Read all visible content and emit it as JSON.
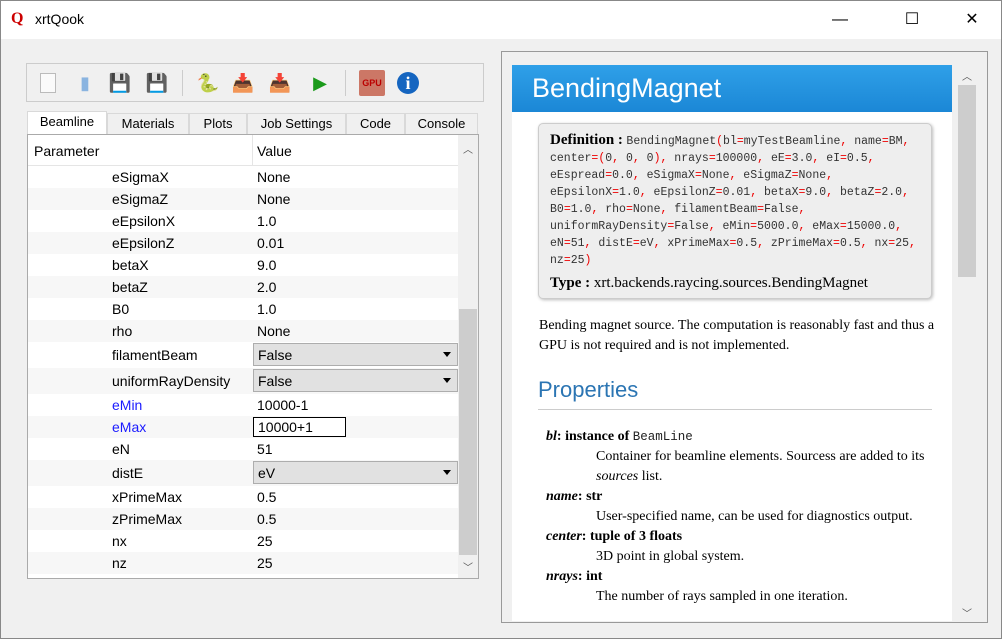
{
  "window": {
    "title": "xrtQook",
    "app_icon": "xrt",
    "minimize": "—",
    "maximize": "☐",
    "close": "✕"
  },
  "toolbar": [
    "new-icon",
    "open-icon",
    "save-icon",
    "save-as-icon",
    "python-code-icon",
    "save-python-icon",
    "save-python-as-icon",
    "run-icon",
    "gpu-icon",
    "info-icon"
  ],
  "tabs": [
    "Beamline",
    "Materials",
    "Plots",
    "Job Settings",
    "Code",
    "Console"
  ],
  "table": {
    "headers": [
      "Parameter",
      "Value"
    ],
    "rows": [
      {
        "k": "eSigmaX",
        "v": "None"
      },
      {
        "k": "eSigmaZ",
        "v": "None"
      },
      {
        "k": "eEpsilonX",
        "v": "1.0"
      },
      {
        "k": "eEpsilonZ",
        "v": "0.01"
      },
      {
        "k": "betaX",
        "v": "9.0"
      },
      {
        "k": "betaZ",
        "v": "2.0"
      },
      {
        "k": "B0",
        "v": "1.0"
      },
      {
        "k": "rho",
        "v": "None"
      },
      {
        "k": "filamentBeam",
        "v": "False",
        "combo": true
      },
      {
        "k": "uniformRayDensity",
        "v": "False",
        "combo": true
      },
      {
        "k": "eMin",
        "v": "10000-1",
        "blue": true
      },
      {
        "k": "eMax",
        "v": "10000+1",
        "blue": true,
        "edit": true
      },
      {
        "k": "eN",
        "v": "51"
      },
      {
        "k": "distE",
        "v": "eV",
        "combo": true
      },
      {
        "k": "xPrimeMax",
        "v": "0.5"
      },
      {
        "k": "zPrimeMax",
        "v": "0.5"
      },
      {
        "k": "nx",
        "v": "25"
      },
      {
        "k": "nz",
        "v": "25"
      }
    ]
  },
  "doc": {
    "title": "BendingMagnet",
    "definition_label": "Definition :",
    "definition": "BendingMagnet(bl=myTestBeamline, name=BM, center=(0, 0, 0), nrays=100000, eE=3.0, eI=0.5, eEspread=0.0, eSigmaX=None, eSigmaZ=None, eEpsilonX=1.0, eEpsilonZ=0.01, betaX=9.0, betaZ=2.0, B0=1.0, rho=None, filamentBeam=False, uniformRayDensity=False, eMin=5000.0, eMax=15000.0, eN=51, distE=eV, xPrimeMax=0.5, zPrimeMax=0.5, nx=25, nz=25)",
    "type_label": "Type :",
    "type": "xrt.backends.raycing.sources.BendingMagnet",
    "description": "Bending magnet source. The computation is reasonably fast and thus a GPU is not required and is not implemented.",
    "properties_title": "Properties",
    "properties": [
      {
        "name": "bl",
        "type": "instance of ",
        "type_code": "BeamLine",
        "desc": "Container for beamline elements. Sourcess are added to its ",
        "desc_em": "sources",
        "desc_tail": " list."
      },
      {
        "name": "name",
        "type": "str",
        "desc": "User-specified name, can be used for diagnostics output."
      },
      {
        "name": "center",
        "type": "tuple of 3 floats",
        "desc": "3D point in global system."
      },
      {
        "name": "nrays",
        "type": "int",
        "desc": "The number of rays sampled in one iteration."
      }
    ]
  }
}
